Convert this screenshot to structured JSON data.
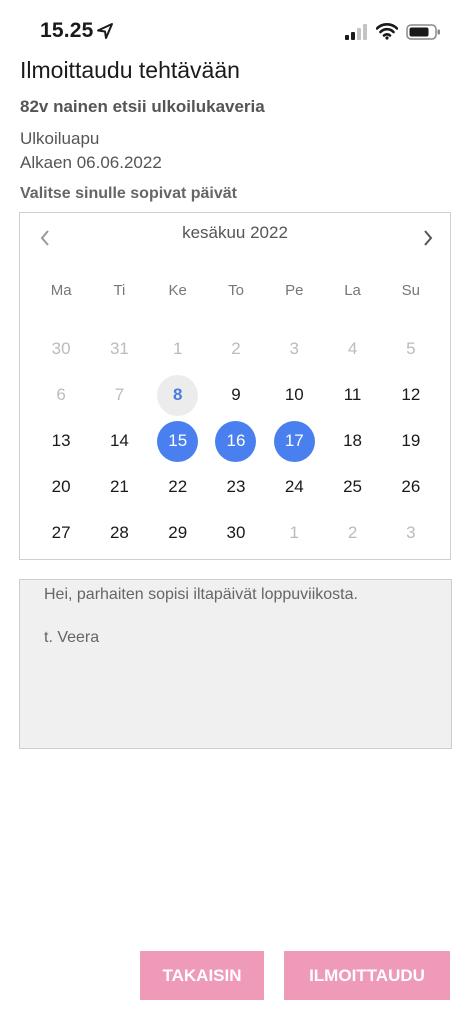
{
  "status_bar": {
    "time": "15.25"
  },
  "page_title": "Ilmoittaudu tehtävään",
  "task": {
    "title": "82v nainen etsii ulkoilukaveria",
    "category": "Ulkoiluapu",
    "start_date": "Alkaen 06.06.2022"
  },
  "select_label": "Valitse sinulle sopivat päivät",
  "calendar": {
    "month": "kesäkuu 2022",
    "weekdays": [
      "Ma",
      "Ti",
      "Ke",
      "To",
      "Pe",
      "La",
      "Su"
    ],
    "days": [
      {
        "label": "30",
        "state": "other"
      },
      {
        "label": "31",
        "state": "other"
      },
      {
        "label": "1",
        "state": "disabled"
      },
      {
        "label": "2",
        "state": "disabled"
      },
      {
        "label": "3",
        "state": "disabled"
      },
      {
        "label": "4",
        "state": "disabled"
      },
      {
        "label": "5",
        "state": "disabled"
      },
      {
        "label": "6",
        "state": "disabled"
      },
      {
        "label": "7",
        "state": "disabled"
      },
      {
        "label": "8",
        "state": "today"
      },
      {
        "label": "9",
        "state": "normal"
      },
      {
        "label": "10",
        "state": "normal"
      },
      {
        "label": "11",
        "state": "normal"
      },
      {
        "label": "12",
        "state": "normal"
      },
      {
        "label": "13",
        "state": "normal"
      },
      {
        "label": "14",
        "state": "normal"
      },
      {
        "label": "15",
        "state": "selected"
      },
      {
        "label": "16",
        "state": "selected"
      },
      {
        "label": "17",
        "state": "selected"
      },
      {
        "label": "18",
        "state": "normal"
      },
      {
        "label": "19",
        "state": "normal"
      },
      {
        "label": "20",
        "state": "normal"
      },
      {
        "label": "21",
        "state": "normal"
      },
      {
        "label": "22",
        "state": "normal"
      },
      {
        "label": "23",
        "state": "normal"
      },
      {
        "label": "24",
        "state": "normal"
      },
      {
        "label": "25",
        "state": "normal"
      },
      {
        "label": "26",
        "state": "normal"
      },
      {
        "label": "27",
        "state": "normal"
      },
      {
        "label": "28",
        "state": "normal"
      },
      {
        "label": "29",
        "state": "normal"
      },
      {
        "label": "30",
        "state": "normal"
      },
      {
        "label": "1",
        "state": "other"
      },
      {
        "label": "2",
        "state": "other"
      },
      {
        "label": "3",
        "state": "other"
      }
    ]
  },
  "message": {
    "line1": "Hei, parhaiten sopisi iltapäivät loppuviikosta.",
    "line2": "t. Veera"
  },
  "buttons": {
    "back": "TAKAISIN",
    "submit": "ILMOITTAUDU"
  },
  "colors": {
    "selected": "#4a7ff0",
    "button": "#ee9ab8"
  }
}
